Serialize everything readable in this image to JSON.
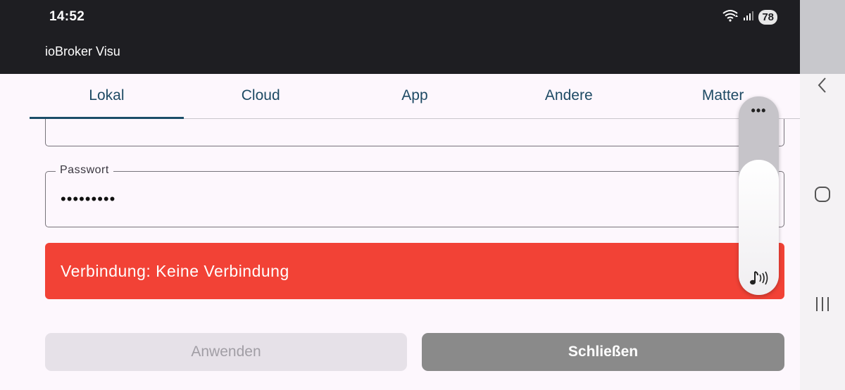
{
  "status_bar": {
    "time": "14:52",
    "battery": "78",
    "icons": [
      "wifi-icon",
      "signal-icon",
      "battery-icon"
    ]
  },
  "app": {
    "title": "ioBroker Visu"
  },
  "tabs": [
    {
      "label": "Lokal",
      "active": true
    },
    {
      "label": "Cloud",
      "active": false
    },
    {
      "label": "App",
      "active": false
    },
    {
      "label": "Andere",
      "active": false
    },
    {
      "label": "Matter",
      "active": false
    }
  ],
  "form": {
    "password": {
      "label": "Passwort",
      "value": "•••••••••"
    }
  },
  "connection_banner": {
    "text": "Verbindung: Keine Verbindung",
    "color": "#f24236"
  },
  "buttons": {
    "apply": "Anwenden",
    "close": "Schließen"
  },
  "volume_overlay": {
    "level": 0.68,
    "more_label": "•••",
    "icon": "music-volume-icon"
  },
  "navigation": {
    "icons": [
      "back-icon",
      "home-icon",
      "recents-icon"
    ]
  },
  "colors": {
    "accent": "#1b4d68",
    "error": "#f24236",
    "header_bg": "#1e1e22"
  }
}
